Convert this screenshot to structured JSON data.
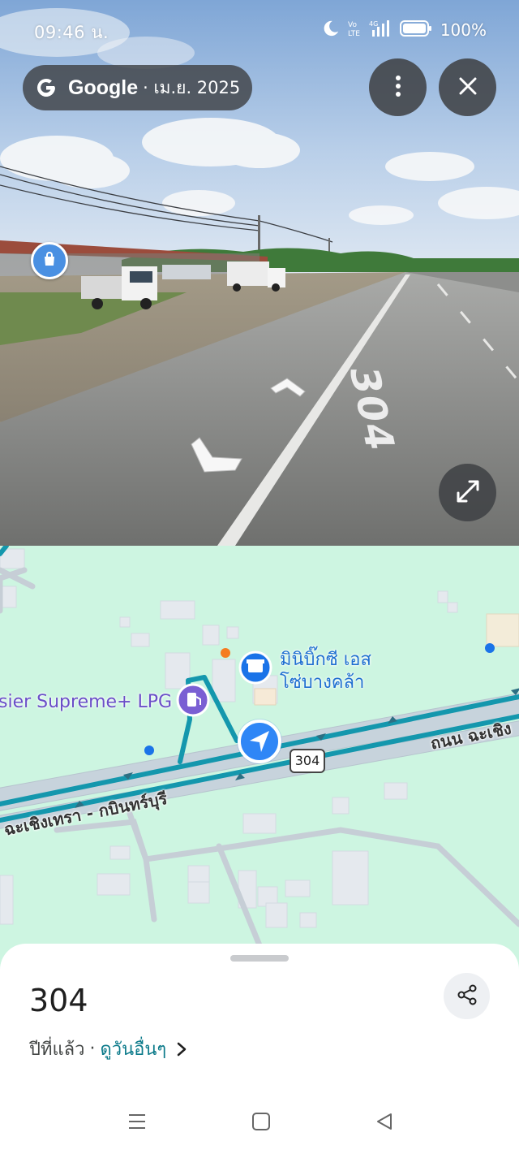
{
  "status_bar": {
    "time": "09:46 น.",
    "battery": "100%",
    "icons": [
      "moon-icon",
      "volte-icon",
      "4g-signal-icon",
      "battery-icon"
    ]
  },
  "header": {
    "brand": "Google",
    "capture_date": "· เม.ย. 2025",
    "icons": [
      "google-g-icon",
      "more-vert-icon",
      "close-icon",
      "fullscreen-icon"
    ]
  },
  "street_view": {
    "road_marking": "304"
  },
  "map": {
    "poi_name_line1": "มินิบิ๊กซี เอส",
    "poi_name_line2": "โซ่บางคล้า",
    "fuel_station": "sier Supreme+ LPG",
    "road_left": "ฉะเชิงเทรา - กบินทร์บุรี",
    "road_right": "ถนน ฉะเชิง",
    "route_shield": "304",
    "colors": {
      "land": "#cdf5e1",
      "highway": "#c7d3dc",
      "route_line": "#1497ad",
      "poi_blue": "#1a73e8",
      "fuel_purple": "#7a5fd3"
    }
  },
  "sheet": {
    "title": "304",
    "when": "ปีที่แล้ว",
    "separator": "·",
    "see_more": "ดูวันอื่นๆ"
  },
  "nav_bar": {
    "icons": [
      "recents-icon",
      "home-icon",
      "back-icon"
    ]
  }
}
